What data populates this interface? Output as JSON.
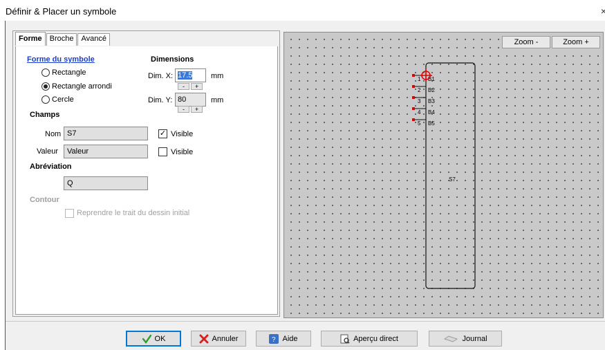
{
  "window": {
    "title": "Définir & Placer un symbole",
    "close": "×"
  },
  "tabs": [
    "Forme",
    "Broche",
    "Avancé"
  ],
  "forme": {
    "section_title": "Forme du symbole",
    "options": [
      "Rectangle",
      "Rectangle arrondi",
      "Cercle"
    ],
    "selected": "Rectangle arrondi"
  },
  "dimensions": {
    "title": "Dimensions",
    "x_label": "Dim. X:",
    "x_value": "17.5",
    "x_unit": "mm",
    "y_label": "Dim. Y:",
    "y_value": "80",
    "y_unit": "mm",
    "minus": "-",
    "plus": "+"
  },
  "champs": {
    "title": "Champs",
    "nom_label": "Nom",
    "nom_value": "S7",
    "nom_visible_label": "Visible",
    "nom_visible": true,
    "valeur_label": "Valeur",
    "valeur_value": "Valeur",
    "valeur_visible_label": "Visible",
    "valeur_visible": false
  },
  "abreviation": {
    "title": "Abréviation",
    "value": "Q"
  },
  "contour": {
    "title": "Contour",
    "checkbox_label": "Reprendre le trait du dessin initial",
    "checked": false
  },
  "preview": {
    "zoom_minus": "Zoom -",
    "zoom_plus": "Zoom +",
    "symbol_name": "S7",
    "pins": [
      {
        "number": "1",
        "name": "B1"
      },
      {
        "number": "2",
        "name": "B2"
      },
      {
        "number": "3",
        "name": "B3"
      },
      {
        "number": "4",
        "name": "B4"
      },
      {
        "number": "5",
        "name": "B5"
      }
    ],
    "colors": {
      "pin_mark": "#e00000",
      "grid_bg": "#c9c9c9"
    }
  },
  "buttons": {
    "ok": "OK",
    "annuler": "Annuler",
    "aide": "Aide",
    "apercu": "Aperçu direct",
    "journal": "Journal"
  }
}
